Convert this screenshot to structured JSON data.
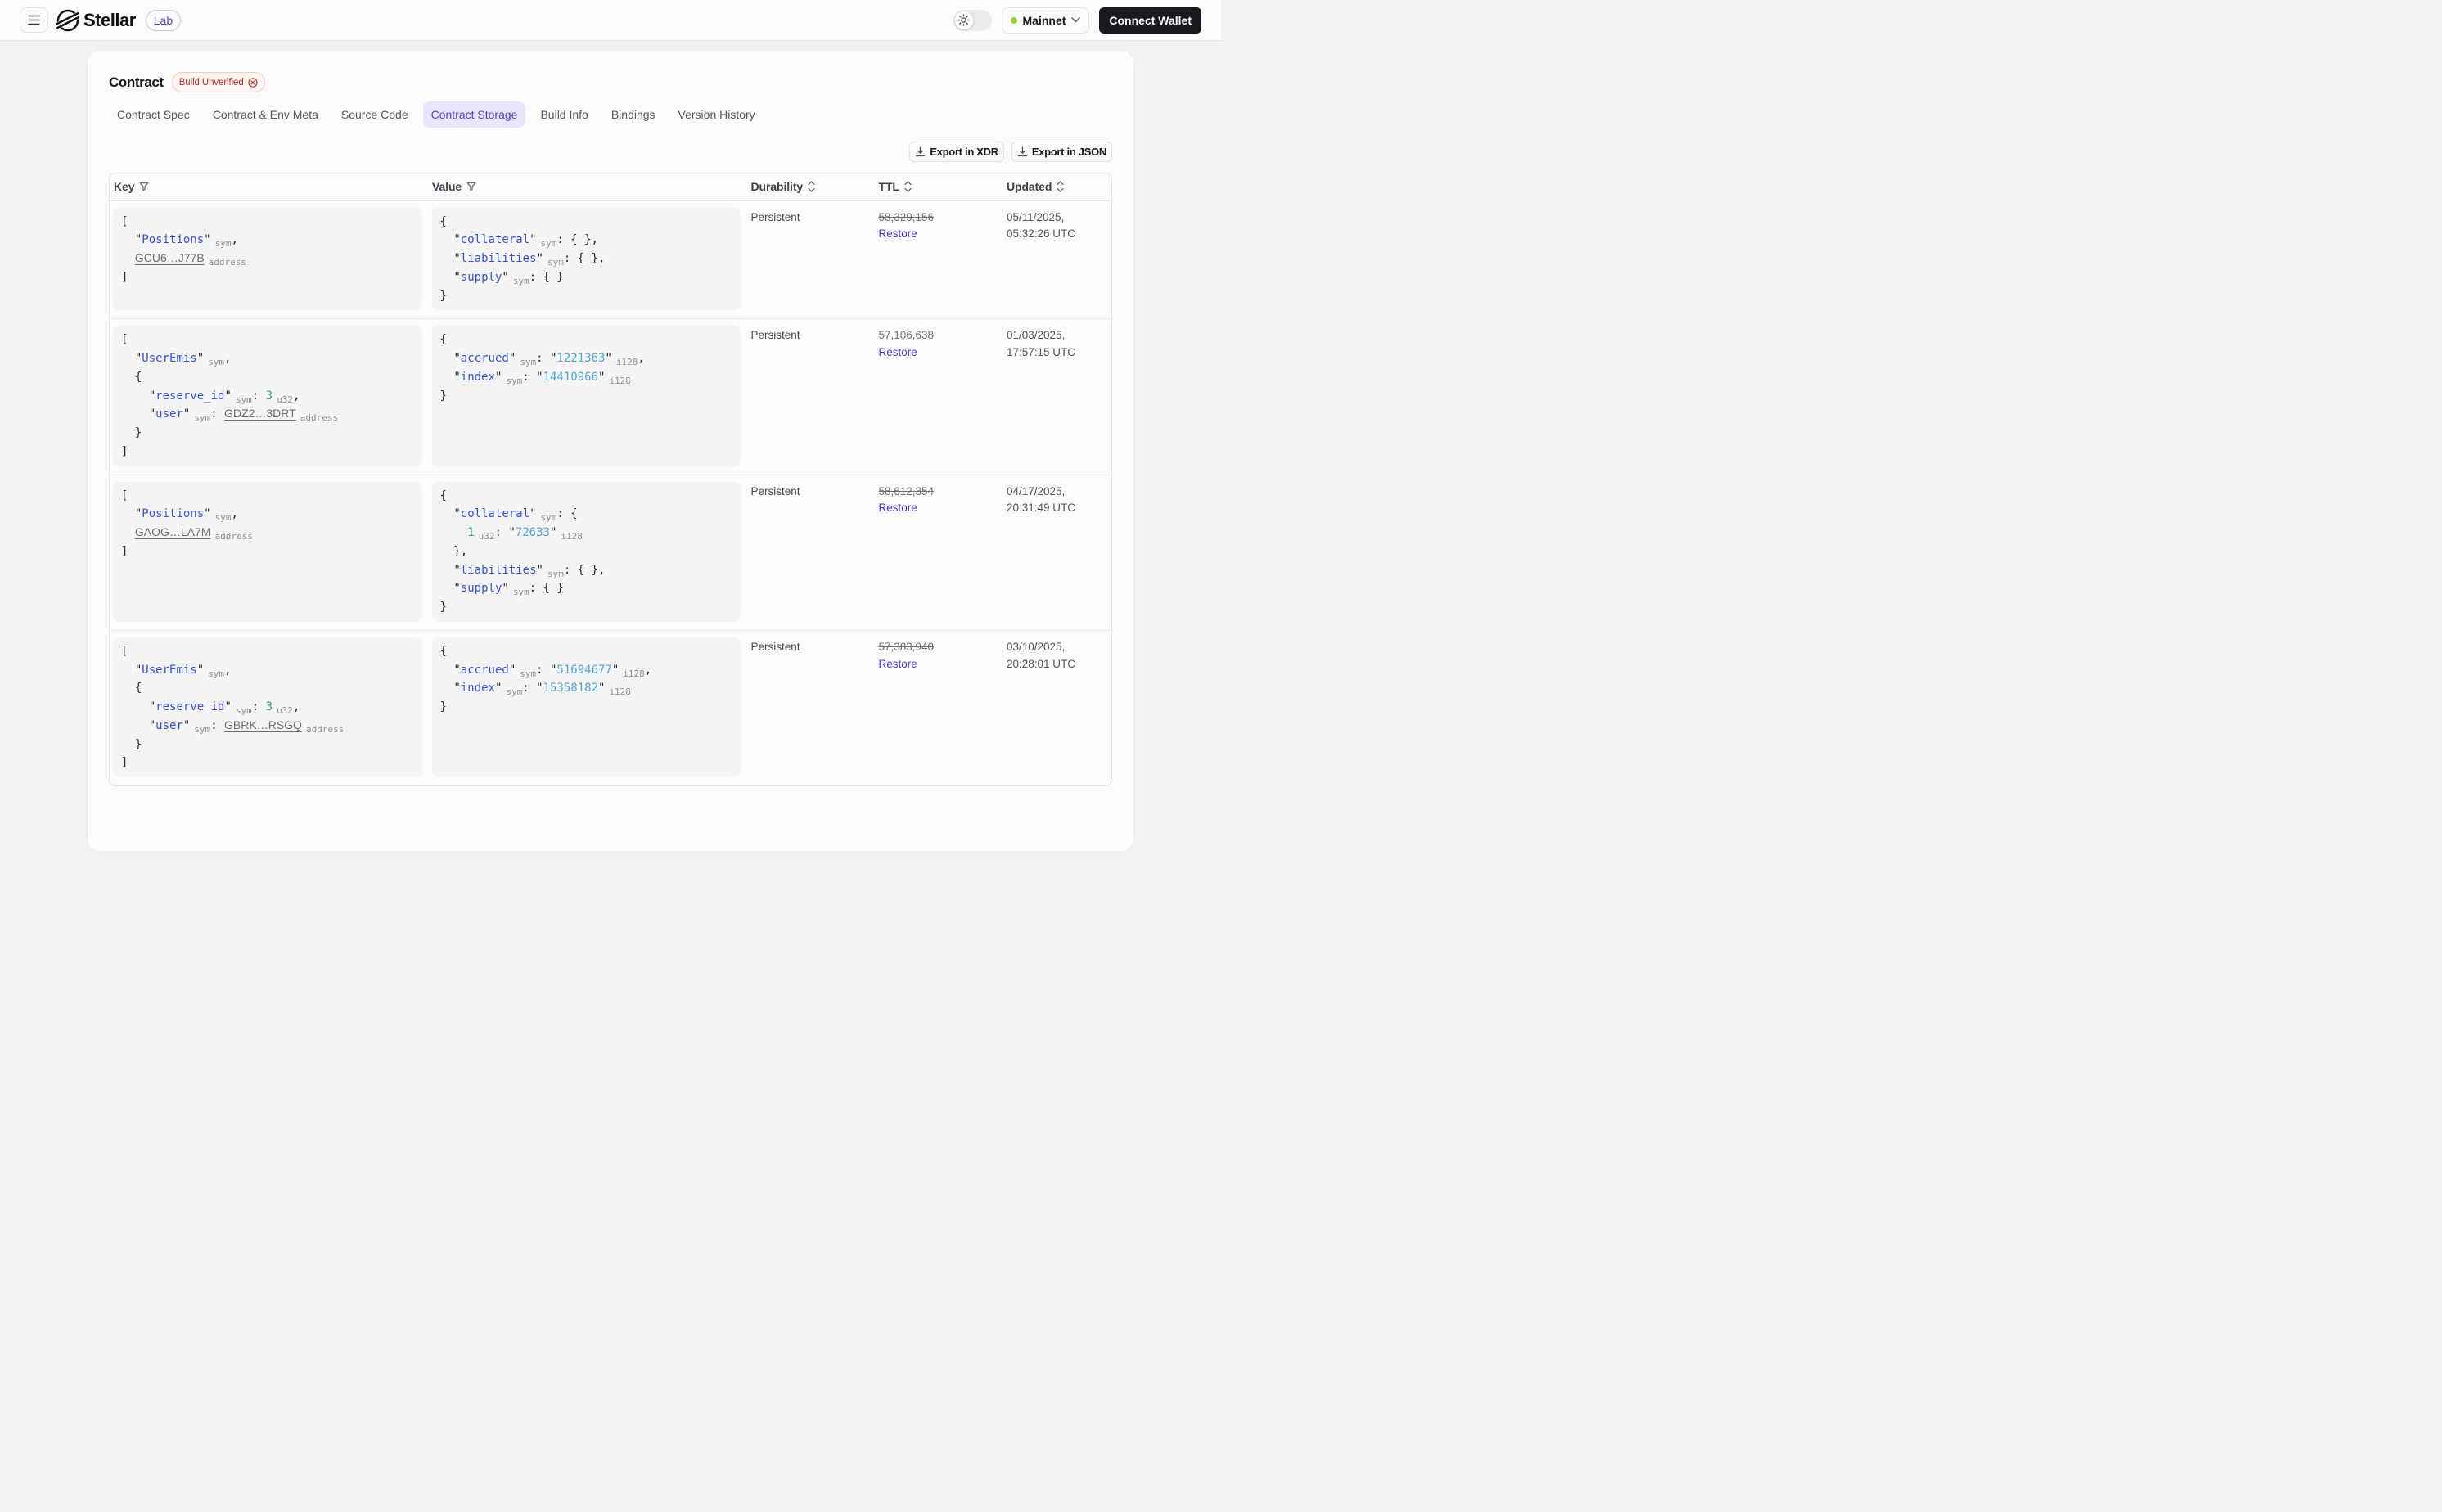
{
  "colors": {
    "accent_purple": "#5a46c8",
    "accent_purple_bg": "#e9e5fa",
    "link_purple": "#4b3ac6",
    "status_red_text": "#ad3228",
    "status_red_bg": "#fdf4f2",
    "network_dot_green": "#a3cc3e",
    "code_key_blue": "#3853cb",
    "code_string_cyan": "#55a6cd",
    "code_number_green": "#36a47e",
    "connect_button_bg": "#1a1a1e"
  },
  "icons": {
    "menu": "hamburger-icon",
    "brand": "stellar-logo",
    "theme": "sun-icon",
    "network_caret": "chevron-down-icon",
    "export": "download-icon",
    "key_filter": "filter-icon",
    "value_filter": "filter-icon",
    "sort": "sort-updown-icon",
    "status_close": "circle-x-icon"
  },
  "header": {
    "brand": "Stellar",
    "badge": "Lab",
    "network": {
      "label": "Mainnet"
    },
    "connect_button": "Connect Wallet"
  },
  "page": {
    "title": "Contract",
    "status_badge": "Build Unverified"
  },
  "tabs": [
    {
      "label": "Contract Spec",
      "active": false
    },
    {
      "label": "Contract & Env Meta",
      "active": false
    },
    {
      "label": "Source Code",
      "active": false
    },
    {
      "label": "Contract Storage",
      "active": true
    },
    {
      "label": "Build Info",
      "active": false
    },
    {
      "label": "Bindings",
      "active": false
    },
    {
      "label": "Version History",
      "active": false
    }
  ],
  "toolbar": {
    "export_xdr": "Export in XDR",
    "export_json": "Export in JSON"
  },
  "storage_table": {
    "columns": [
      {
        "label": "Key",
        "icon": "filter"
      },
      {
        "label": "Value",
        "icon": "filter"
      },
      {
        "label": "Durability",
        "icon": "sort"
      },
      {
        "label": "TTL",
        "icon": "sort"
      },
      {
        "label": "Updated",
        "icon": "sort"
      }
    ],
    "rows": [
      {
        "key_lines": [
          {
            "ind": 0,
            "tokens": [
              [
                "p",
                "["
              ]
            ]
          },
          {
            "ind": 1,
            "tokens": [
              [
                "k",
                "Positions"
              ],
              [
                "t",
                "sym"
              ],
              [
                "p",
                ","
              ]
            ]
          },
          {
            "ind": 1,
            "tokens": [
              [
                "a",
                "GCU6…J77B"
              ],
              [
                "t",
                "address"
              ]
            ]
          },
          {
            "ind": 0,
            "tokens": [
              [
                "p",
                "]"
              ]
            ]
          }
        ],
        "value_lines": [
          {
            "ind": 0,
            "tokens": [
              [
                "p",
                "{"
              ]
            ]
          },
          {
            "ind": 1,
            "tokens": [
              [
                "k",
                "collateral"
              ],
              [
                "t",
                "sym"
              ],
              [
                "p",
                ": { },"
              ]
            ]
          },
          {
            "ind": 1,
            "tokens": [
              [
                "k",
                "liabilities"
              ],
              [
                "t",
                "sym"
              ],
              [
                "p",
                ": { },"
              ]
            ]
          },
          {
            "ind": 1,
            "tokens": [
              [
                "k",
                "supply"
              ],
              [
                "t",
                "sym"
              ],
              [
                "p",
                ": { }"
              ]
            ]
          },
          {
            "ind": 0,
            "tokens": [
              [
                "p",
                "}"
              ]
            ]
          }
        ],
        "durability": "Persistent",
        "ttl": "58,329,156",
        "ttl_action": "Restore",
        "updated_date": "05/11/2025,",
        "updated_time": "05:32:26 UTC"
      },
      {
        "key_lines": [
          {
            "ind": 0,
            "tokens": [
              [
                "p",
                "["
              ]
            ]
          },
          {
            "ind": 1,
            "tokens": [
              [
                "k",
                "UserEmis"
              ],
              [
                "t",
                "sym"
              ],
              [
                "p",
                ","
              ]
            ]
          },
          {
            "ind": 1,
            "tokens": [
              [
                "p",
                "{"
              ]
            ]
          },
          {
            "ind": 2,
            "tokens": [
              [
                "k",
                "reserve_id"
              ],
              [
                "t",
                "sym"
              ],
              [
                "p",
                ": "
              ],
              [
                "n",
                "3"
              ],
              [
                "t",
                "u32"
              ],
              [
                "p",
                ","
              ]
            ]
          },
          {
            "ind": 2,
            "tokens": [
              [
                "k",
                "user"
              ],
              [
                "t",
                "sym"
              ],
              [
                "p",
                ": "
              ],
              [
                "a",
                "GDZ2…3DRT"
              ],
              [
                "t",
                "address"
              ]
            ]
          },
          {
            "ind": 1,
            "tokens": [
              [
                "p",
                "}"
              ]
            ]
          },
          {
            "ind": 0,
            "tokens": [
              [
                "p",
                "]"
              ]
            ]
          }
        ],
        "value_lines": [
          {
            "ind": 0,
            "tokens": [
              [
                "p",
                "{"
              ]
            ]
          },
          {
            "ind": 1,
            "tokens": [
              [
                "k",
                "accrued"
              ],
              [
                "t",
                "sym"
              ],
              [
                "p",
                ": "
              ],
              [
                "s",
                "1221363"
              ],
              [
                "t",
                "i128"
              ],
              [
                "p",
                ","
              ]
            ]
          },
          {
            "ind": 1,
            "tokens": [
              [
                "k",
                "index"
              ],
              [
                "t",
                "sym"
              ],
              [
                "p",
                ": "
              ],
              [
                "s",
                "14410966"
              ],
              [
                "t",
                "i128"
              ]
            ]
          },
          {
            "ind": 0,
            "tokens": [
              [
                "p",
                "}"
              ]
            ]
          }
        ],
        "durability": "Persistent",
        "ttl": "57,106,638",
        "ttl_action": "Restore",
        "updated_date": "01/03/2025,",
        "updated_time": "17:57:15 UTC"
      },
      {
        "key_lines": [
          {
            "ind": 0,
            "tokens": [
              [
                "p",
                "["
              ]
            ]
          },
          {
            "ind": 1,
            "tokens": [
              [
                "k",
                "Positions"
              ],
              [
                "t",
                "sym"
              ],
              [
                "p",
                ","
              ]
            ]
          },
          {
            "ind": 1,
            "tokens": [
              [
                "a",
                "GAOG…LA7M"
              ],
              [
                "t",
                "address"
              ]
            ]
          },
          {
            "ind": 0,
            "tokens": [
              [
                "p",
                "]"
              ]
            ]
          }
        ],
        "value_lines": [
          {
            "ind": 0,
            "tokens": [
              [
                "p",
                "{"
              ]
            ]
          },
          {
            "ind": 1,
            "tokens": [
              [
                "k",
                "collateral"
              ],
              [
                "t",
                "sym"
              ],
              [
                "p",
                ": {"
              ]
            ]
          },
          {
            "ind": 2,
            "tokens": [
              [
                "n",
                "1"
              ],
              [
                "t",
                "u32"
              ],
              [
                "p",
                ": "
              ],
              [
                "s",
                "72633"
              ],
              [
                "t",
                "i128"
              ]
            ]
          },
          {
            "ind": 1,
            "tokens": [
              [
                "p",
                "},"
              ]
            ]
          },
          {
            "ind": 1,
            "tokens": [
              [
                "k",
                "liabilities"
              ],
              [
                "t",
                "sym"
              ],
              [
                "p",
                ": { },"
              ]
            ]
          },
          {
            "ind": 1,
            "tokens": [
              [
                "k",
                "supply"
              ],
              [
                "t",
                "sym"
              ],
              [
                "p",
                ": { }"
              ]
            ]
          },
          {
            "ind": 0,
            "tokens": [
              [
                "p",
                "}"
              ]
            ]
          }
        ],
        "durability": "Persistent",
        "ttl": "58,612,354",
        "ttl_action": "Restore",
        "updated_date": "04/17/2025,",
        "updated_time": "20:31:49 UTC"
      },
      {
        "key_lines": [
          {
            "ind": 0,
            "tokens": [
              [
                "p",
                "["
              ]
            ]
          },
          {
            "ind": 1,
            "tokens": [
              [
                "k",
                "UserEmis"
              ],
              [
                "t",
                "sym"
              ],
              [
                "p",
                ","
              ]
            ]
          },
          {
            "ind": 1,
            "tokens": [
              [
                "p",
                "{"
              ]
            ]
          },
          {
            "ind": 2,
            "tokens": [
              [
                "k",
                "reserve_id"
              ],
              [
                "t",
                "sym"
              ],
              [
                "p",
                ": "
              ],
              [
                "n",
                "3"
              ],
              [
                "t",
                "u32"
              ],
              [
                "p",
                ","
              ]
            ]
          },
          {
            "ind": 2,
            "tokens": [
              [
                "k",
                "user"
              ],
              [
                "t",
                "sym"
              ],
              [
                "p",
                ": "
              ],
              [
                "a",
                "GBRK…RSGQ"
              ],
              [
                "t",
                "address"
              ]
            ]
          },
          {
            "ind": 1,
            "tokens": [
              [
                "p",
                "}"
              ]
            ]
          },
          {
            "ind": 0,
            "tokens": [
              [
                "p",
                "]"
              ]
            ]
          }
        ],
        "value_lines": [
          {
            "ind": 0,
            "tokens": [
              [
                "p",
                "{"
              ]
            ]
          },
          {
            "ind": 1,
            "tokens": [
              [
                "k",
                "accrued"
              ],
              [
                "t",
                "sym"
              ],
              [
                "p",
                ": "
              ],
              [
                "s",
                "51694677"
              ],
              [
                "t",
                "i128"
              ],
              [
                "p",
                ","
              ]
            ]
          },
          {
            "ind": 1,
            "tokens": [
              [
                "k",
                "index"
              ],
              [
                "t",
                "sym"
              ],
              [
                "p",
                ": "
              ],
              [
                "s",
                "15358182"
              ],
              [
                "t",
                "i128"
              ]
            ]
          },
          {
            "ind": 0,
            "tokens": [
              [
                "p",
                "}"
              ]
            ]
          }
        ],
        "durability": "Persistent",
        "ttl": "57,383,940",
        "ttl_action": "Restore",
        "updated_date": "03/10/2025,",
        "updated_time": "20:28:01 UTC"
      }
    ]
  }
}
